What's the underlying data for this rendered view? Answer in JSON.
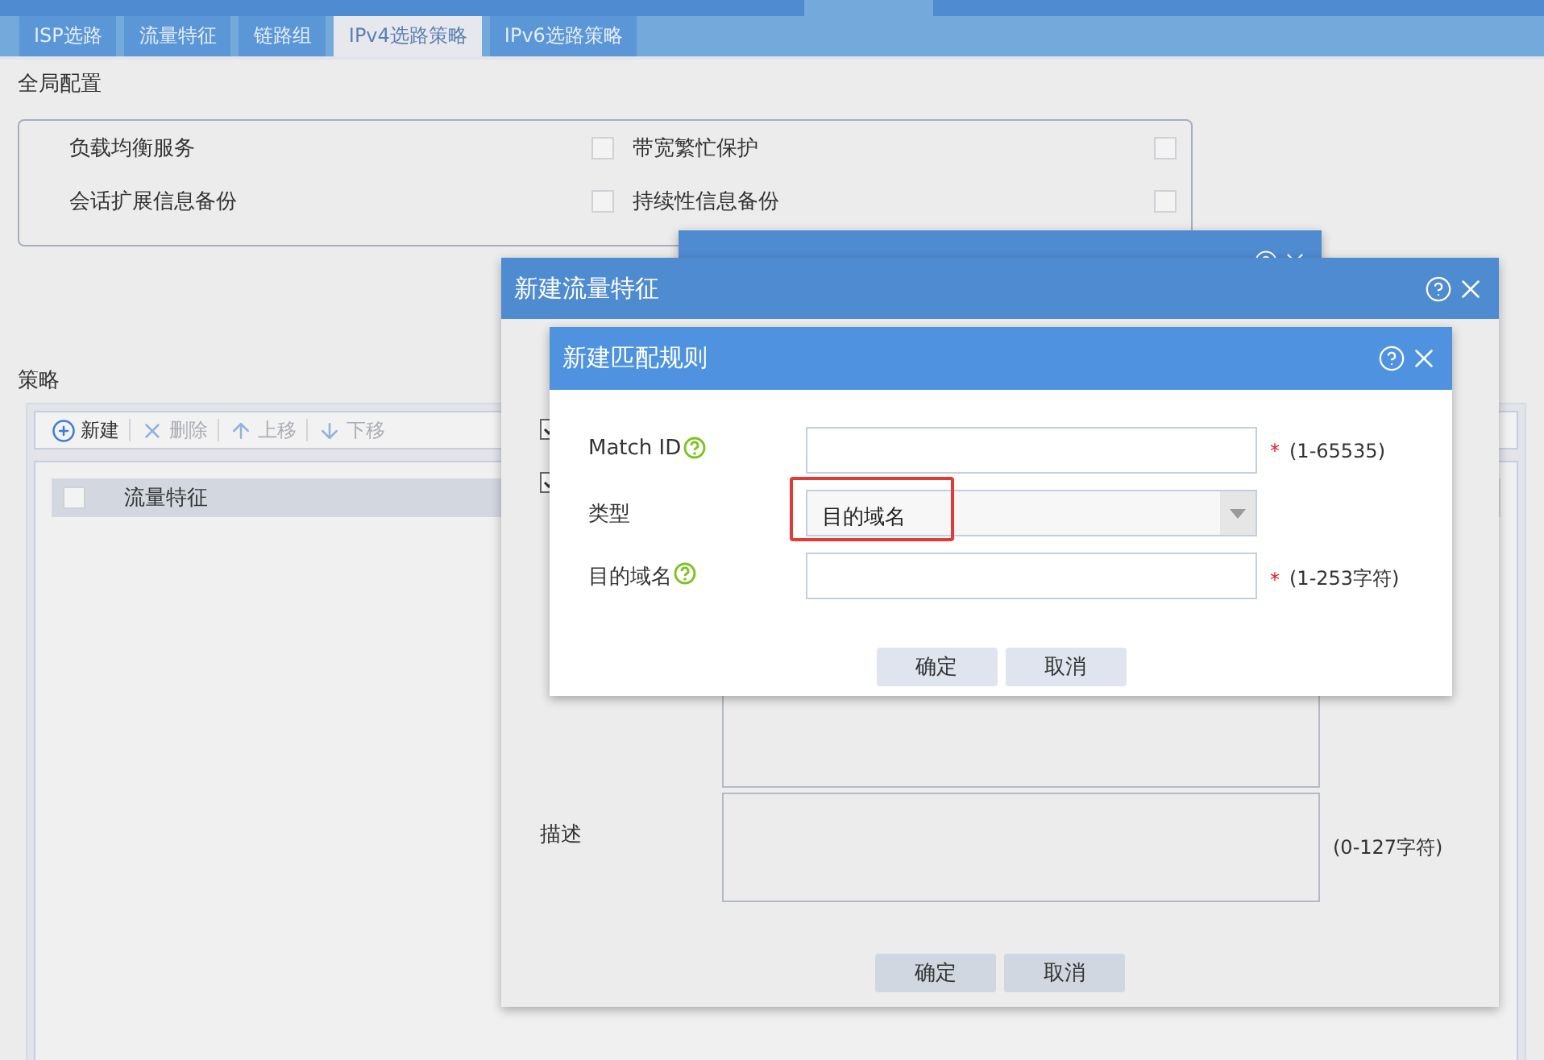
{
  "tabs": [
    {
      "label": "ISP选路",
      "selected": false
    },
    {
      "label": "流量特征",
      "selected": false
    },
    {
      "label": "链路组",
      "selected": false
    },
    {
      "label": "IPv4选路策略",
      "selected": true
    },
    {
      "label": "IPv6选路策略",
      "selected": false
    }
  ],
  "global_config": {
    "title": "全局配置",
    "options": [
      {
        "label": "负载均衡服务",
        "checked": false
      },
      {
        "label": "带宽繁忙保护",
        "checked": false
      },
      {
        "label": "会话扩展信息备份",
        "checked": false
      },
      {
        "label": "持续性信息备份",
        "checked": false
      }
    ]
  },
  "policy": {
    "title": "策略",
    "toolbar": [
      {
        "kind": "add",
        "label": "新建",
        "disabled": false
      },
      {
        "kind": "delete",
        "label": "删除",
        "disabled": true
      },
      {
        "kind": "up",
        "label": "上移",
        "disabled": true
      },
      {
        "kind": "down",
        "label": "下移",
        "disabled": true
      }
    ],
    "table": {
      "select_all_checked": false,
      "columns": [
        "流量特征"
      ]
    }
  },
  "traffic_dialog": {
    "title": "新建流量特征",
    "options": [
      {
        "checked": true
      },
      {
        "checked": true
      }
    ],
    "description_label": "描述",
    "description_hint": "(0-127字符)",
    "buttons": [
      "确定",
      "取消"
    ]
  },
  "rule_dialog": {
    "title": "新建匹配规则",
    "fields": [
      {
        "kind": "input",
        "label": "Match ID",
        "help": true,
        "required_mark": "*",
        "hint": "(1-65535)"
      },
      {
        "kind": "select",
        "label": "类型",
        "value": "目的域名",
        "highlighted": true
      },
      {
        "kind": "input",
        "label": "目的域名",
        "help": true,
        "required_mark": "*",
        "hint": "(1-253字符)"
      }
    ],
    "buttons": [
      "确定",
      "取消"
    ]
  }
}
